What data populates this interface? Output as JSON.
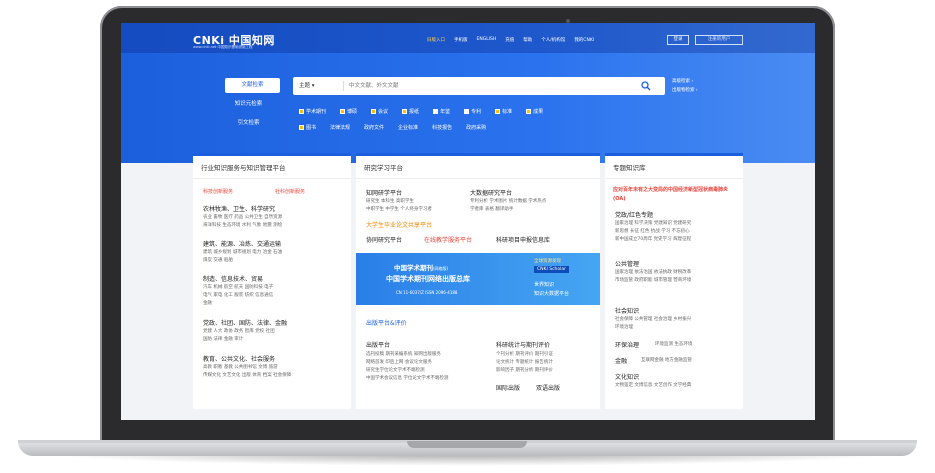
{
  "header": {
    "logo_text": "CNKi 中国知网",
    "logo_url": "www.cnki.net",
    "logo_sub": "中国知识基础设施工程",
    "nav": [
      "旧版入口",
      "手机版",
      "ENGLISH",
      "充值",
      "帮助",
      "个人/机构馆",
      "我的CNKI"
    ],
    "login": "登录",
    "register": "注册新用户"
  },
  "search": {
    "tabs": [
      "文献检索",
      "知识元检索",
      "引文检索"
    ],
    "scope": "主题 ▾",
    "placeholder": "中文文献、外文文献",
    "advanced": "高级检索 ›",
    "publication": "出版物检索 ›"
  },
  "filters": {
    "row1": [
      {
        "label": "学术期刊",
        "checked": true
      },
      {
        "label": "博硕",
        "checked": true
      },
      {
        "label": "会议",
        "checked": true
      },
      {
        "label": "报纸",
        "checked": true
      },
      {
        "label": "年鉴",
        "checked": false
      },
      {
        "label": "专利",
        "checked": false
      },
      {
        "label": "标准",
        "checked": true
      },
      {
        "label": "成果",
        "checked": true
      }
    ],
    "row2": [
      {
        "label": "图书",
        "checked": true
      },
      {
        "label": "法律法规",
        "checked": false
      },
      {
        "label": "政府文件",
        "checked": false
      },
      {
        "label": "企业标准",
        "checked": false
      },
      {
        "label": "科技报告",
        "checked": false
      },
      {
        "label": "政府采购",
        "checked": false
      }
    ]
  },
  "panel1": {
    "title": "行业知识服务与知识管理平台",
    "highlights": [
      "科技创新服务",
      "社科创新服务"
    ],
    "groups": [
      {
        "title": "农林牧渔、卫生、科学研究",
        "lines": [
          "农业 畜牧 医疗 药品 公共卫生 自然资源",
          "海洋科技 生态环境 水利 气象 地震 测绘"
        ]
      },
      {
        "title": "建筑、能源、冶炼、交通运输",
        "lines": [
          "建筑 城乡规划 城市规划 电力 冶金 石油",
          "煤炭 交通 船舶"
        ]
      },
      {
        "title": "制造、信息技术、贸易",
        "lines": [
          "汽车 机械 航空 航天 国防科技 电子",
          "电气 家电 化工 服装 纺织 信息通信",
          "金融"
        ]
      },
      {
        "title": "党政、社团、国防、法律、金融",
        "lines": [
          "党建 人大 政协 政务 智库 党校 社团",
          "国防 法律 金融 审计"
        ]
      },
      {
        "title": "教育、公共文化、社会服务",
        "lines": [
          "高教 职教 基教 公共图书馆 文博 旅游",
          "传媒文化 文艺文化 出版 体育 档案 社会保障"
        ]
      }
    ]
  },
  "panel2": {
    "title": "研究学习平台",
    "sub1": "知网研学平台",
    "sub1_lines": [
      "研究生 本科生 高职学生",
      "中职学生 中学生 个人终身学习者"
    ],
    "sub2": "大数据研究平台",
    "sub2_lines": [
      "专利分析 学术图片 统计数据 学术热点",
      "学者库 表格 翻译助手"
    ],
    "row_a": "大学生毕业论文共享平台",
    "row_b": [
      "协同研究平台",
      "在线教学服务平台",
      "科研项目申报信息库"
    ],
    "ad": {
      "line1": "中国学术期刊",
      "line1_tag": "(网络版)",
      "line2": "中国学术期刊网络出版总库",
      "issn": "CN 11-6037/Z   ISSN 2096-4188",
      "badge": "CNKI Scholar",
      "badge_top": "全球资源发现",
      "tag1": "世界知识",
      "tag2": "知识大数据平台"
    },
    "pub_title": "出版平台&评价",
    "pub_sub1": "出版平台",
    "pub_lines1": [
      "选刊投稿 期刊采编系统 知网出版服务",
      "网络首发 印后上网 会议论文服务",
      "研究生学位论文学术不端检测",
      "中国学术会议信息 学位论文学术不端检测"
    ],
    "pub_sub2": "科研统计与期刊评价",
    "pub_lines2": [
      "个刊分析 期刊评价 期刊引证",
      "论文统计 专题统计 报告统计",
      "影响因子 期刊分析 期刊评价"
    ],
    "pub_links": [
      "国际出版",
      "双语出版"
    ]
  },
  "panel3": {
    "title": "专题知识库",
    "promo": "应对百年未有之大变局的中国经济新型冠状病毒肺炎(OA)",
    "sections": [
      {
        "title": "党政/红色专题",
        "lines": [
          "国家治理 科学决策 党建知识 党建研究",
          "新思想 长征 红色 抗战 学习 不忘初心",
          "新中国成立70周年 党史学习 辉煌征程"
        ]
      },
      {
        "title": "公共管理",
        "lines": [
          "国家治理 依法治国 依法执政 财税改革",
          "市场监管 政府职能 城市管理 营商环境"
        ]
      },
      {
        "title": "社会知识",
        "lines": [
          "社会保障 公共管理 社会治理 乡村振兴",
          "环境治理"
        ]
      },
      {
        "title": "环保治理",
        "lines": [
          "环境监测 生态环境"
        ]
      },
      {
        "title": "金融",
        "lines": [
          "互联网金融 地方金融监管"
        ]
      },
      {
        "title": "文化知识",
        "lines": [
          "文物鉴定 文博信息 文艺创作 文学经典"
        ]
      }
    ]
  },
  "colors": {
    "brand_blue": "#1c5fdc",
    "accent_red": "#e8453c",
    "accent_yellow": "#ffc000"
  }
}
